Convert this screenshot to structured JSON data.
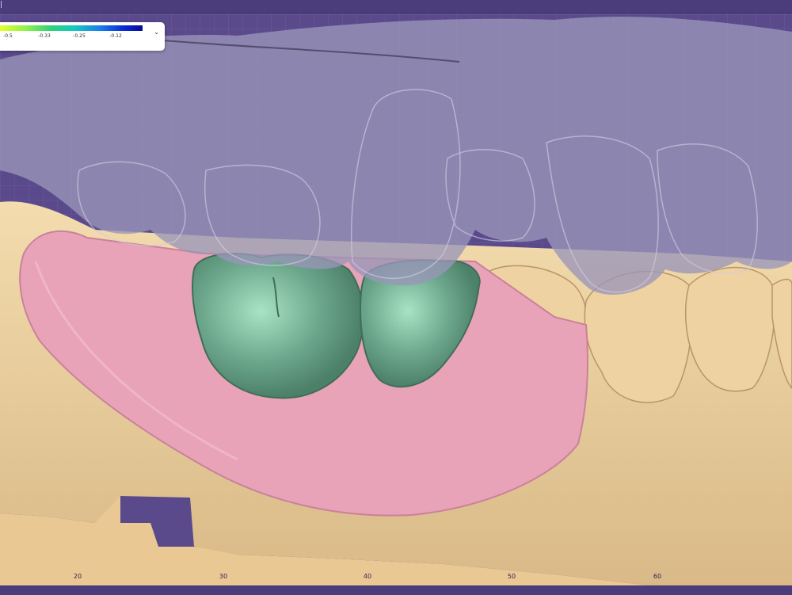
{
  "window": {
    "title": "|"
  },
  "legend": {
    "ticks": [
      "-0.5",
      "-0.33",
      "-0.25",
      "-0.12"
    ],
    "expand_icon": "chevron-down-icon",
    "gradient_colors": [
      "#e8ff2c",
      "#8ef24a",
      "#2fd07a",
      "#13c9c0",
      "#1b7fe9",
      "#0b2fd6",
      "#060a9b"
    ]
  },
  "ruler": {
    "labels": [
      "20",
      "30",
      "40",
      "50",
      "60"
    ]
  },
  "colors": {
    "background": "#5a4a8c",
    "gingiva": "#e8a3b8",
    "crowns": "#6aa58a",
    "model": "#edcf9b",
    "upper_arch": "#9a96b9"
  }
}
